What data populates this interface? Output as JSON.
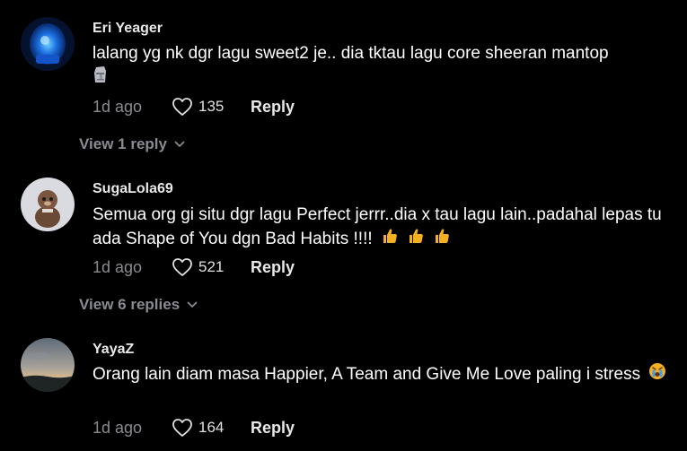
{
  "comments": [
    {
      "username": "Eri Yeager",
      "text": "lalang yg nk dgr lagu sweet2 je.. dia tktau lagu core sheeran mantop",
      "emoji_icon": "moai-icon",
      "time": "1d ago",
      "likes": "135",
      "reply_label": "Reply",
      "view_replies": "View 1 reply"
    },
    {
      "username": "SugaLola69",
      "text": "Semua org gi situ dgr lagu Perfect jerrr..dia x tau lagu lain..padahal lepas tu ada Shape of You dgn Bad Habits !!!!",
      "emoji_icon": "thumbs-up-icon",
      "time": "1d ago",
      "likes": "521",
      "reply_label": "Reply",
      "view_replies": "View 6 replies"
    },
    {
      "username": "YayaZ",
      "text": "Orang lain diam masa Happier, A Team and Give Me Love paling i stress",
      "emoji_icon": "crying-face-icon",
      "time": "1d ago",
      "likes": "164",
      "reply_label": "Reply"
    }
  ],
  "colors": {
    "background": "#000000",
    "text": "#ffffff",
    "muted": "#8a8b91",
    "emoji_yellow": "#f5b021"
  }
}
